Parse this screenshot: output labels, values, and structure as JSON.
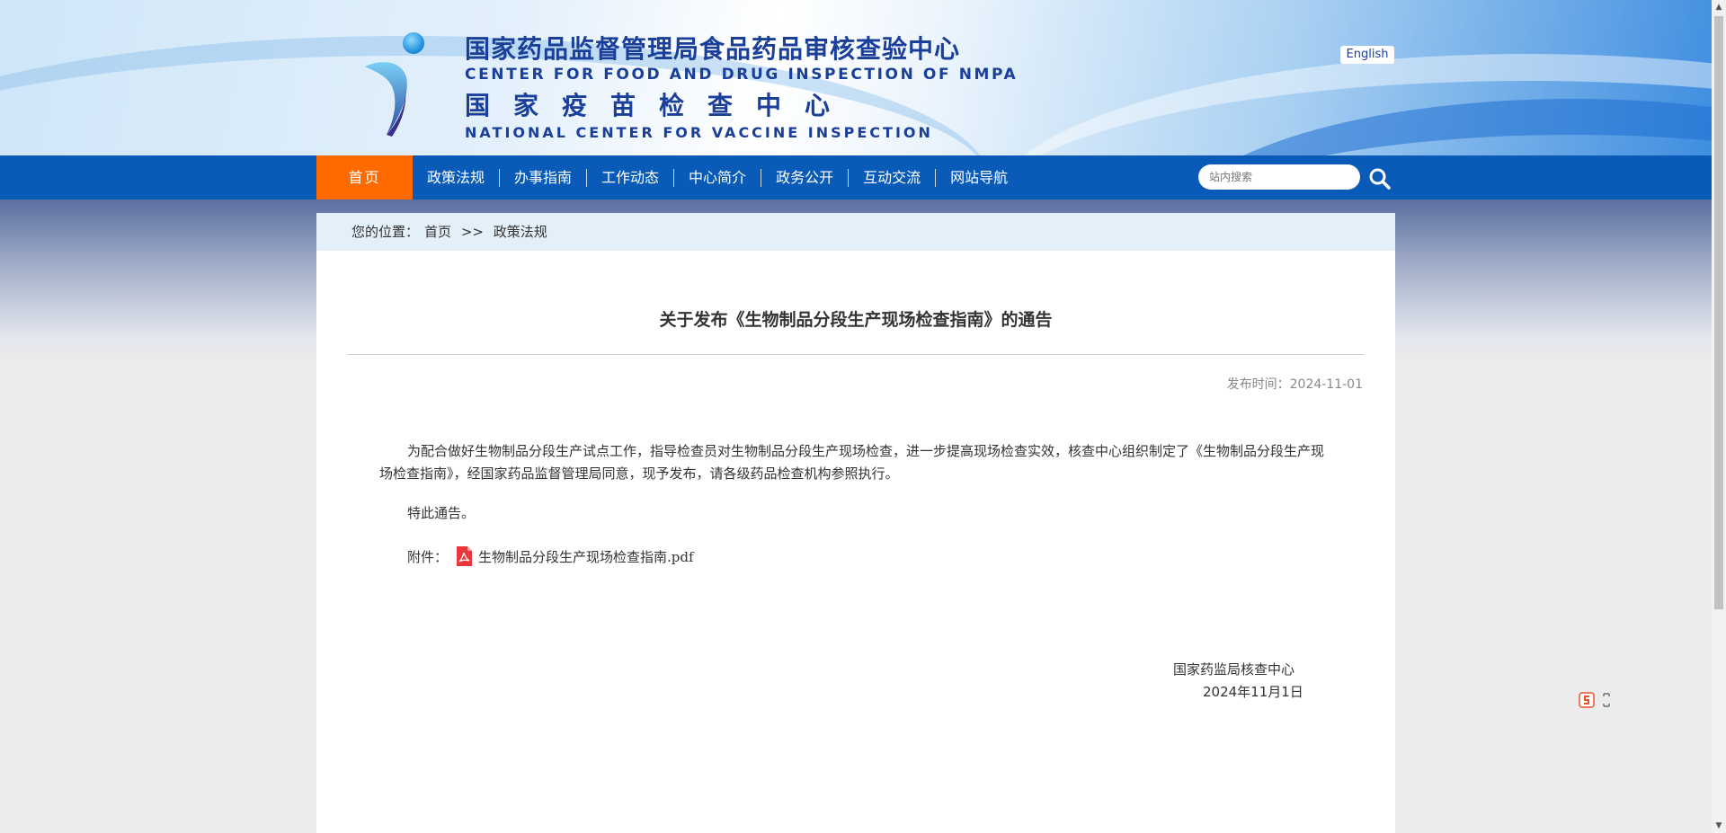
{
  "header": {
    "org_cn": "国家药品监督管理局食品药品审核查验中心",
    "org_en": "CENTER FOR FOOD AND DRUG INSPECTION OF NMPA",
    "center_cn": "国家疫苗检查中心",
    "center_en": "NATIONAL CENTER FOR VACCINE INSPECTION",
    "lang_button": "English"
  },
  "nav": {
    "items": [
      {
        "label": "首页",
        "active": true
      },
      {
        "label": "政策法规"
      },
      {
        "label": "办事指南"
      },
      {
        "label": "工作动态"
      },
      {
        "label": "中心简介"
      },
      {
        "label": "政务公开"
      },
      {
        "label": "互动交流"
      },
      {
        "label": "网站导航"
      }
    ],
    "search_placeholder": "站内搜索"
  },
  "breadcrumb": {
    "prefix": "您的位置：",
    "home": "首页",
    "sep": ">>",
    "current": "政策法规"
  },
  "article": {
    "title": "关于发布《生物制品分段生产现场检查指南》的通告",
    "publish_time": "发布时间：2024-11-01",
    "para1": "为配合做好生物制品分段生产试点工作，指导检查员对生物制品分段生产现场检查，进一步提高现场检查实效，核查中心组织制定了《生物制品分段生产现场检查指南》，经国家药品监督管理局同意，现予发布，请各级药品检查机构参照执行。",
    "para2": "特此通告。",
    "attachment_label": "附件：",
    "attachment_name": "生物制品分段生产现场检查指南.pdf",
    "signature_org": "国家药监局核查中心",
    "signature_date": "2024年11月1日"
  },
  "icons": [
    "search-icon",
    "pdf-icon",
    "sogou-icon"
  ],
  "colors": {
    "nav_bg": "#0a5bb8",
    "nav_active": "#ff6a00",
    "brand_text": "#1a3f9a",
    "crumb_bg": "#e3eff9"
  }
}
